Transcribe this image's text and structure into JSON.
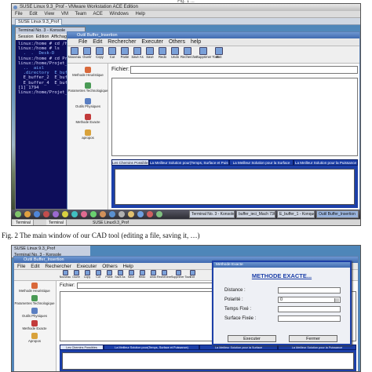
{
  "top_cut_caption": "Fig. 1 ...",
  "figure1": {
    "vm_title": "SUSE Linux 9.3_Prof - VMware Workstation ACE Edition",
    "vm_menu": [
      "File",
      "Edit",
      "View",
      "VM",
      "Team",
      "ACE",
      "Windows",
      "Help"
    ],
    "vm_tabs": [
      "SUSE Linux 9.3_Prof"
    ],
    "terminal": {
      "title": "Terminal No. 3 - Konsole",
      "menu": [
        "Session",
        "Edition",
        "Affichage",
        "Si"
      ],
      "lines": [
        "linux:/home # cd /home/",
        "linux:/home # ls",
        "  .  .  Desk-D",
        "linux:/home # cd Projet_",
        "linux:/home/Projet_Buff",
        "  ..  aisl",
        "  .directory  E_buffer_1",
        "  E_buffer_2  E_buffer_3",
        "  E_buffer_4  E_buffer_5",
        "[1] 1794",
        "linux:/home/Projet_Buff"
      ]
    },
    "app": {
      "title": "Outil Buffer_Insertion",
      "menu": [
        "File",
        "Edit",
        "Rechercher",
        "Executer",
        "Others",
        "help"
      ],
      "toolbar": [
        "Nouveau",
        "Ouvrir",
        "Copy",
        "Cut",
        "Paste",
        "Save As",
        "Save",
        "Redo",
        "Undo",
        "Rechercher",
        "Supprimer Tous",
        "Exit"
      ],
      "side": [
        "Methode Heuristique",
        "Parametres Technologique",
        "Outils Physiques",
        "Methode Exacte",
        "apropos"
      ],
      "fichier_label": "Fichier:",
      "tabs": [
        "Les Chemins Possibles",
        "La Meilleur Solution pour(Temps, Surface et Puissance)",
        "La Meilleur Solution pour la Surface",
        "La Meilleur Solution pour la Puissance"
      ]
    },
    "taskbar_buttons": [
      "Terminal No. 3 - Konsole",
      "buffer_ieci_Mach 736 & 2 3:00",
      "E_buffer_1 - Konqueror",
      "Outil Buffer_Insertion"
    ],
    "bottom_tabs": [
      "Terminal",
      "Terminal"
    ],
    "bottom_status": [
      "SUSE Linux9.3_Prof"
    ],
    "caption": "Fig. 2 The main window of our CAD tool (editing a file, saving it, …)"
  },
  "figure2": {
    "terminal": [
      "SUSE Linux 9.3_Prof",
      "Terminal No. 3 - Konsole"
    ],
    "app": {
      "title": "Outil Buffer_Insertion",
      "menu": [
        "File",
        "Edit",
        "Rechercher",
        "Executer",
        "Others",
        "Help"
      ],
      "toolbar": [
        "Nouveau",
        "Ouvrir",
        "Copy",
        "Cut",
        "Paste",
        "Save As",
        "Save",
        "Redo",
        "Undo",
        "Rechercher",
        "Supprimer Tous",
        "Exit"
      ],
      "side": [
        "Methode Heuristique",
        "Parametres Technologique",
        "Outils Physiques",
        "Methode Exacte",
        "Apropos"
      ],
      "fichier_label": "Fichier:",
      "tabs": [
        "Les Chemins Possibles",
        "La Meilleur Solution pour(Temps, Surface et Puissance)",
        "La Meilleur Solution pour la Surface",
        "La Meilleur Solution pour la Puissance"
      ]
    },
    "dialog": {
      "title": "Methode Exacte",
      "heading": "METHODE EXACTE...",
      "fields": [
        {
          "label": "Distance :",
          "value": ""
        },
        {
          "label": "Polarité :",
          "value": "0"
        },
        {
          "label": "Temps Fixé :",
          "value": ""
        },
        {
          "label": "Surface Fixée :",
          "value": ""
        }
      ],
      "execute_label": "Executer",
      "close_label": "Fermer"
    }
  }
}
